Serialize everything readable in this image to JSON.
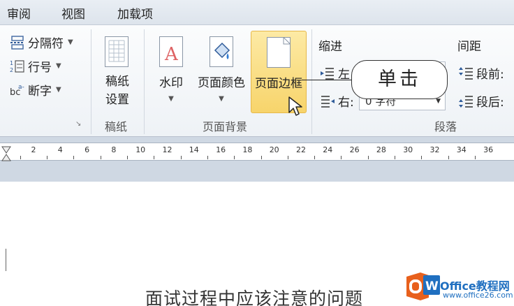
{
  "tabs": [
    "审阅",
    "视图",
    "加载项"
  ],
  "ribbon": {
    "manuscript_small": [
      {
        "label": "分隔符",
        "icon": "page-break-icon"
      },
      {
        "label": "行号",
        "icon": "line-numbers-icon"
      },
      {
        "label": "断字",
        "icon": "hyphenation-icon"
      }
    ],
    "manuscript": {
      "button_line1": "稿纸",
      "button_line2": "设置",
      "group_label": "稿纸"
    },
    "page_background": {
      "watermark": "水印",
      "page_color": "页面颜色",
      "page_borders": "页面边框",
      "group_label": "页面背景"
    },
    "paragraph": {
      "indent_label": "缩进",
      "left_label": "左",
      "right_label": "右:",
      "right_value": "0 字符",
      "spacing_label": "间距",
      "before_label": "段前:",
      "after_label": "段后:",
      "group_label": "段落"
    }
  },
  "ruler": {
    "numbers": [
      "2",
      "4",
      "6",
      "8",
      "10",
      "12",
      "14",
      "16",
      "18",
      "20",
      "22",
      "24",
      "26",
      "28",
      "30",
      "32",
      "34",
      "36"
    ]
  },
  "callout": {
    "text": "单击"
  },
  "document": {
    "text": "面试过程中应该注意的问题"
  },
  "watermark": {
    "brand": "Office教程网",
    "url": "www.office26.com"
  },
  "colors": {
    "highlight": "#f7d46b",
    "ribbon_bg": "#eef2f6",
    "ruler_bg": "#cfd8e3",
    "brand_orange": "#e8601c",
    "brand_blue": "#1f6fc0"
  }
}
